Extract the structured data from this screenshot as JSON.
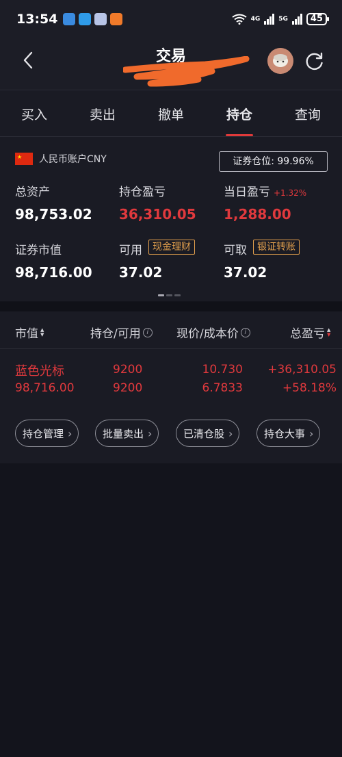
{
  "status_bar": {
    "time": "13:54",
    "net1": "6",
    "net2": "4G",
    "net3": "5G",
    "battery": "45"
  },
  "header": {
    "title": "交易"
  },
  "tabs": [
    {
      "label": "买入"
    },
    {
      "label": "卖出"
    },
    {
      "label": "撤单"
    },
    {
      "label": "持仓",
      "active": true
    },
    {
      "label": "查询"
    }
  ],
  "account": {
    "label": "人民币账户CNY",
    "position_label": "证券仓位:",
    "position_value": "99.96%",
    "total_assets_label": "总资产",
    "total_assets": "98,753.02",
    "holding_pl_label": "持仓盈亏",
    "holding_pl": "36,310.05",
    "daily_pl_label": "当日盈亏",
    "daily_pl_pct": "+1.32%",
    "daily_pl": "1,288.00",
    "market_value_label": "证券市值",
    "market_value": "98,716.00",
    "available_label": "可用",
    "available": "37.02",
    "wealth_btn": "现金理财",
    "withdrawable_label": "可取",
    "withdrawable": "37.02",
    "transfer_btn": "银证转账"
  },
  "holdings": {
    "columns": {
      "market_value": "市值",
      "holding_available": "持仓/可用",
      "price_cost": "现价/成本价",
      "total_pl": "总盈亏"
    },
    "rows": [
      {
        "name": "蓝色光标",
        "market_value": "98,716.00",
        "holding": "9200",
        "available": "9200",
        "price": "10.730",
        "cost": "6.7833",
        "pl": "+36,310.05",
        "pl_pct": "+58.18%"
      }
    ],
    "actions": [
      "持仓管理",
      "批量卖出",
      "已清仓股",
      "持仓大事"
    ]
  },
  "colors": {
    "up_red": "#e0393d",
    "accent_orange": "#e3a04d",
    "background": "#13141c",
    "panel": "#1a1b24"
  }
}
